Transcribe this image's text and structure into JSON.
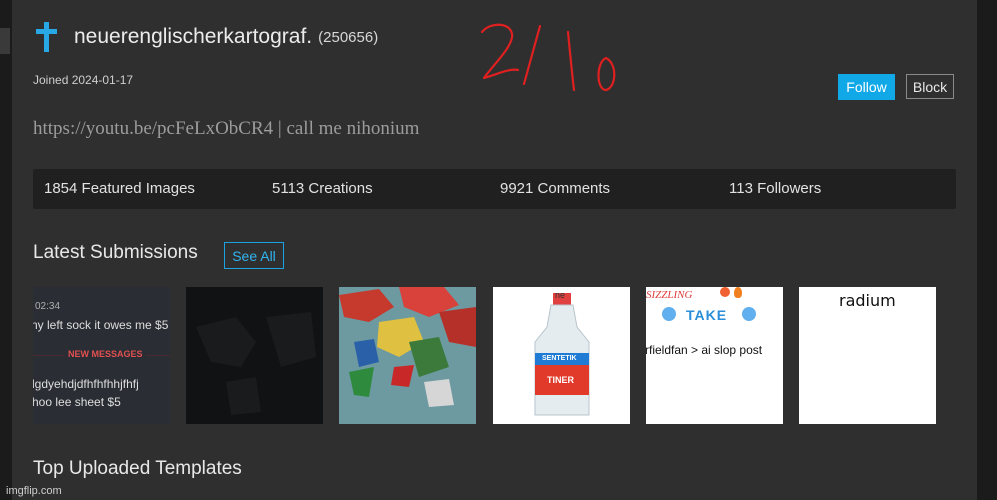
{
  "profile": {
    "username": "neuerenglischerkartograf.",
    "user_id": "(250656)",
    "joined": "Joined 2024-01-17",
    "bio": "https://youtu.be/pcFeLxObCR4 | call me nihonium",
    "icon": "cross-icon",
    "icon_color": "#28a9e6"
  },
  "annotation": {
    "text": "2/10",
    "color": "#e02020"
  },
  "actions": {
    "follow_label": "Follow",
    "block_label": "Block",
    "follow_color": "#11a8e8"
  },
  "stats": [
    {
      "label": "1854 Featured Images"
    },
    {
      "label": "5113 Creations"
    },
    {
      "label": "9921 Comments"
    },
    {
      "label": "113 Followers"
    }
  ],
  "latest": {
    "title": "Latest Submissions",
    "see_all_label": "See All",
    "thumbs": [
      {
        "time": "02:34",
        "line1": "ny left sock it owes me $5",
        "divider": "NEW MESSAGES",
        "line2": "lgdyehdjdfhfhfhhjfhfj",
        "line3": "hoo lee sheet $5"
      },
      {},
      {},
      {
        "top_text": "ne",
        "label_top": "SENTETIK",
        "label_main": "TINER"
      },
      {
        "top_text": "SIZZLING",
        "take": "TAKE",
        "caption": "rfieldfan > ai slop post"
      },
      {
        "caption": "radium"
      }
    ]
  },
  "templates": {
    "title": "Top Uploaded Templates"
  },
  "watermark": "imgflip.com"
}
